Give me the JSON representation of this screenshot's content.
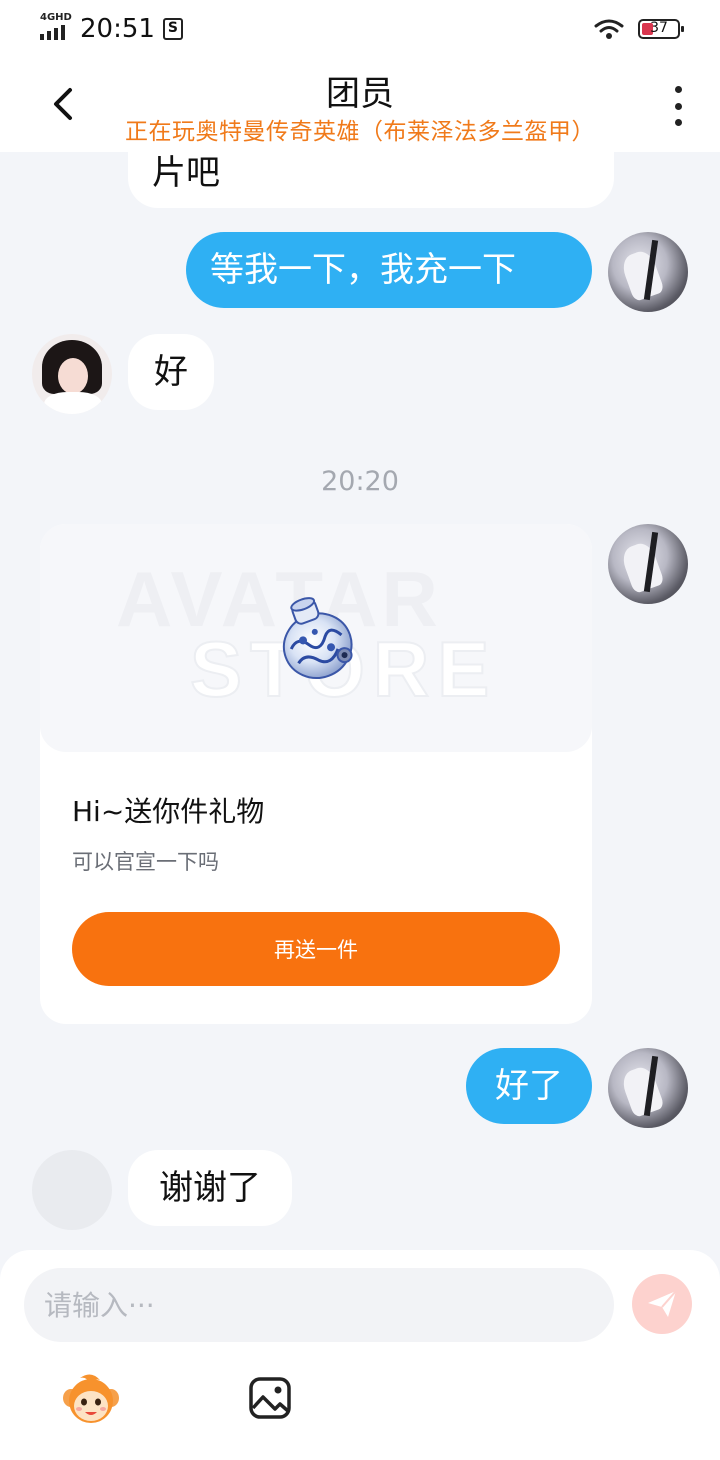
{
  "status_bar": {
    "network": "4GHD",
    "time": "20:51",
    "sim_icon": "S",
    "battery": "37"
  },
  "header": {
    "title": "团员",
    "subtitle": "正在玩奥特曼传奇英雄（布莱泽法多兰盔甲）"
  },
  "messages": {
    "m1": "片吧",
    "m2": "等我一下，我充一下",
    "m3": "好",
    "timestamp": "20:20",
    "m5": "好了",
    "m6": "谢谢了"
  },
  "gift_card": {
    "watermark_line1": "AVATAR",
    "watermark_line2": "STORE",
    "title": "Hi~送你件礼物",
    "message": "可以官宣一下吗",
    "button": "再送一件"
  },
  "input": {
    "placeholder": "请输入···"
  },
  "colors": {
    "accent_blue": "#2fb0f3",
    "accent_orange": "#f8720f",
    "subtitle_orange": "#f07a1a",
    "send_button_disabled": "#fdd2ce"
  },
  "icons": [
    "back-icon",
    "more-icon",
    "send-icon",
    "emoji-mascot-icon",
    "image-icon",
    "wifi-icon",
    "signal-icon",
    "battery-icon"
  ]
}
